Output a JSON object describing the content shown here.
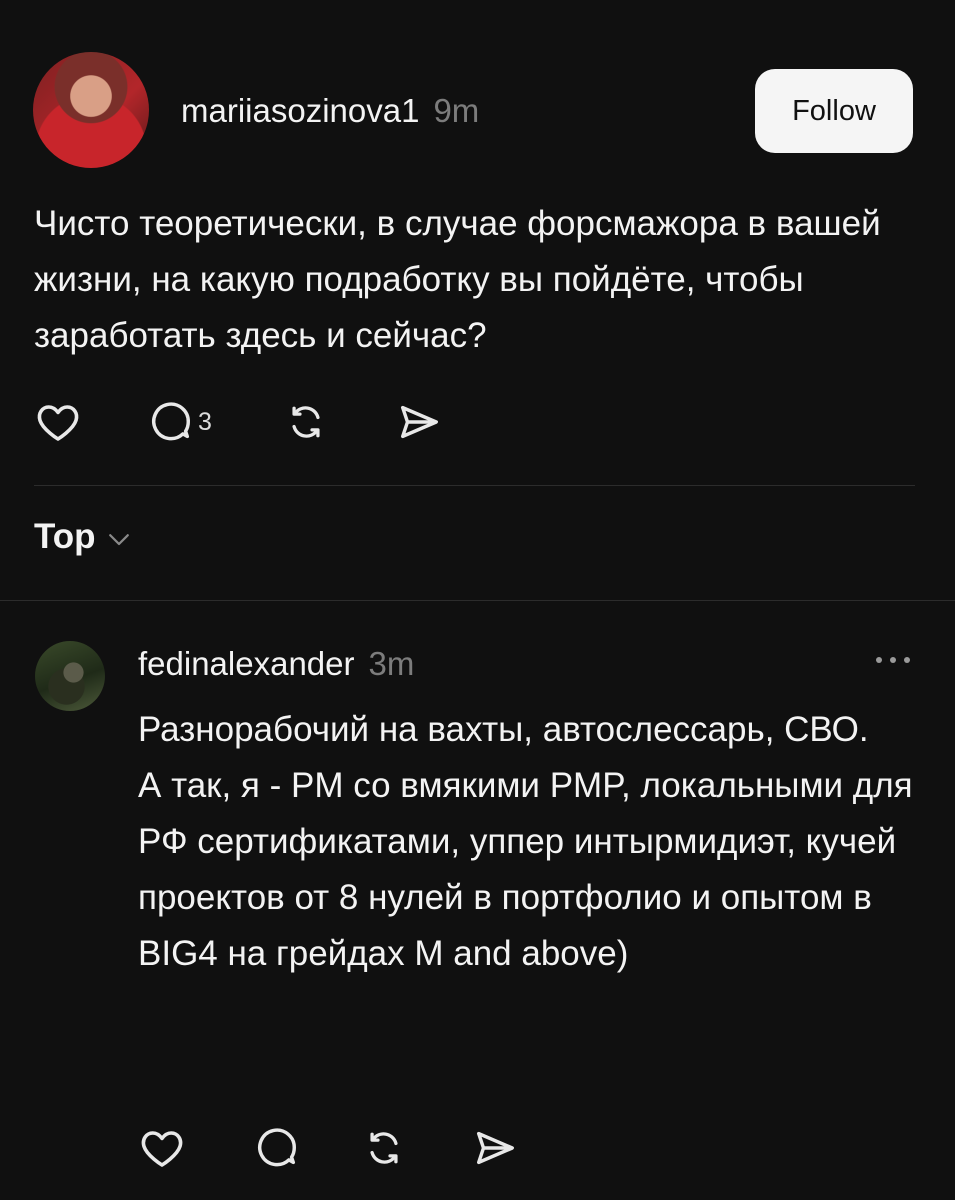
{
  "post": {
    "author": "mariiasozinova1",
    "time": "9m",
    "follow_label": "Follow",
    "text": "Чисто теоретически, в случае форсмажора в вашей жизни, на какую подработку вы пойдёте, чтобы заработать здесь и сейчас?",
    "actions": {
      "like_icon": "heart-icon",
      "reply_icon": "comment-icon",
      "reply_count": "3",
      "repost_icon": "repost-icon",
      "share_icon": "send-icon"
    }
  },
  "sort": {
    "label": "Top",
    "icon": "chevron-down-icon"
  },
  "reply": {
    "author": "fedinalexander",
    "time": "3m",
    "more_icon": "more-icon",
    "text": "Разнорабочий на вахты, автослесcарь, СВО.\nА так, я - PM со вмякими PMP, локальными для РФ сертификатами, уппер интырмидиэт, кучей проектов от 8 нулей в портфолио и опытом в BIG4 на грейдах M and above)"
  },
  "colors": {
    "background": "#101010",
    "text": "#f3f3f3",
    "muted": "#7c7c7c",
    "follow_bg": "#f5f5f5"
  }
}
